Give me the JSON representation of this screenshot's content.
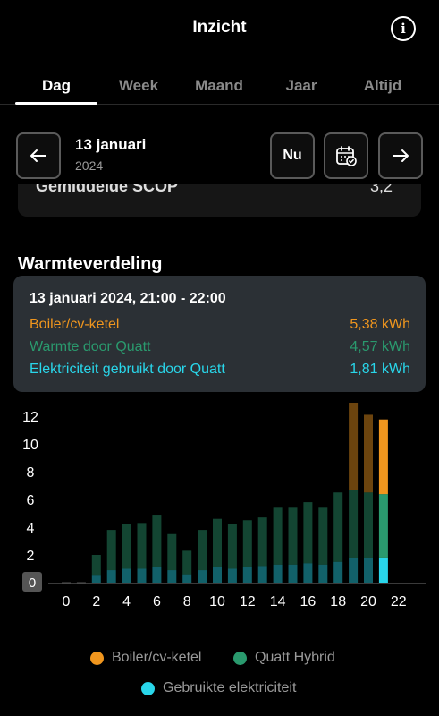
{
  "header": {
    "title": "Inzicht",
    "info_icon": "info-icon"
  },
  "tabs": [
    {
      "label": "Dag",
      "active": true
    },
    {
      "label": "Week",
      "active": false
    },
    {
      "label": "Maand",
      "active": false
    },
    {
      "label": "Jaar",
      "active": false
    },
    {
      "label": "Altijd",
      "active": false
    }
  ],
  "date_nav": {
    "date": "13 januari",
    "year": "2024",
    "now_label": "Nu",
    "prev_icon": "arrow-left-icon",
    "next_icon": "arrow-right-icon",
    "calendar_icon": "calendar-icon"
  },
  "previous_card": {
    "label": "Gemiddelde SCOP",
    "value": "3,2"
  },
  "section_title": "Warmteverdeling",
  "tooltip": {
    "title": "13 januari 2024, 21:00 - 22:00",
    "rows": [
      {
        "label": "Boiler/cv-ketel",
        "value": "5,38 kWh",
        "color": "#f0961e"
      },
      {
        "label": "Warmte door Quatt",
        "value": "4,57 kWh",
        "color": "#2a9a6e"
      },
      {
        "label": "Elektriciteit gebruikt door Quatt",
        "value": "1,81 kWh",
        "color": "#29d6ea"
      }
    ]
  },
  "legend": [
    {
      "label": "Boiler/cv-ketel",
      "color": "#f0961e"
    },
    {
      "label": "Quatt Hybrid",
      "color": "#2a9a6e"
    },
    {
      "label": "Gebruikte elektriciteit",
      "color": "#29d6ea"
    }
  ],
  "chart_data": {
    "type": "bar",
    "stacked": true,
    "x": [
      0,
      1,
      2,
      3,
      4,
      5,
      6,
      7,
      8,
      9,
      10,
      11,
      12,
      13,
      14,
      15,
      16,
      17,
      18,
      19,
      20,
      21,
      22,
      23
    ],
    "series": [
      {
        "name": "Gebruikte elektriciteit",
        "color": "#29d6ea",
        "values": [
          0,
          0,
          0.5,
          0.9,
          1.0,
          1.0,
          1.1,
          0.9,
          0.6,
          0.9,
          1.1,
          1.0,
          1.1,
          1.2,
          1.3,
          1.3,
          1.4,
          1.3,
          1.5,
          1.8,
          1.8,
          1.81,
          0,
          0
        ]
      },
      {
        "name": "Quatt Hybrid",
        "color": "#2a9a6e",
        "values": [
          0,
          0,
          1.5,
          2.9,
          3.2,
          3.3,
          3.8,
          2.6,
          1.7,
          2.9,
          3.5,
          3.2,
          3.4,
          3.5,
          4.1,
          4.1,
          4.4,
          4.1,
          5.0,
          4.9,
          4.7,
          4.57,
          0,
          0
        ]
      },
      {
        "name": "Boiler/cv-ketel",
        "color": "#f0961e",
        "values": [
          0,
          0,
          0,
          0,
          0,
          0,
          0,
          0,
          0,
          0,
          0,
          0,
          0,
          0,
          0,
          0,
          0,
          0,
          0,
          6.6,
          5.6,
          5.38,
          0,
          0
        ]
      }
    ],
    "selected_index": 21,
    "yticks": [
      0,
      2,
      4,
      6,
      8,
      10,
      12
    ],
    "xticks": [
      0,
      2,
      4,
      6,
      8,
      10,
      12,
      14,
      16,
      18,
      20,
      22
    ],
    "ylim": [
      0,
      12.5
    ]
  }
}
